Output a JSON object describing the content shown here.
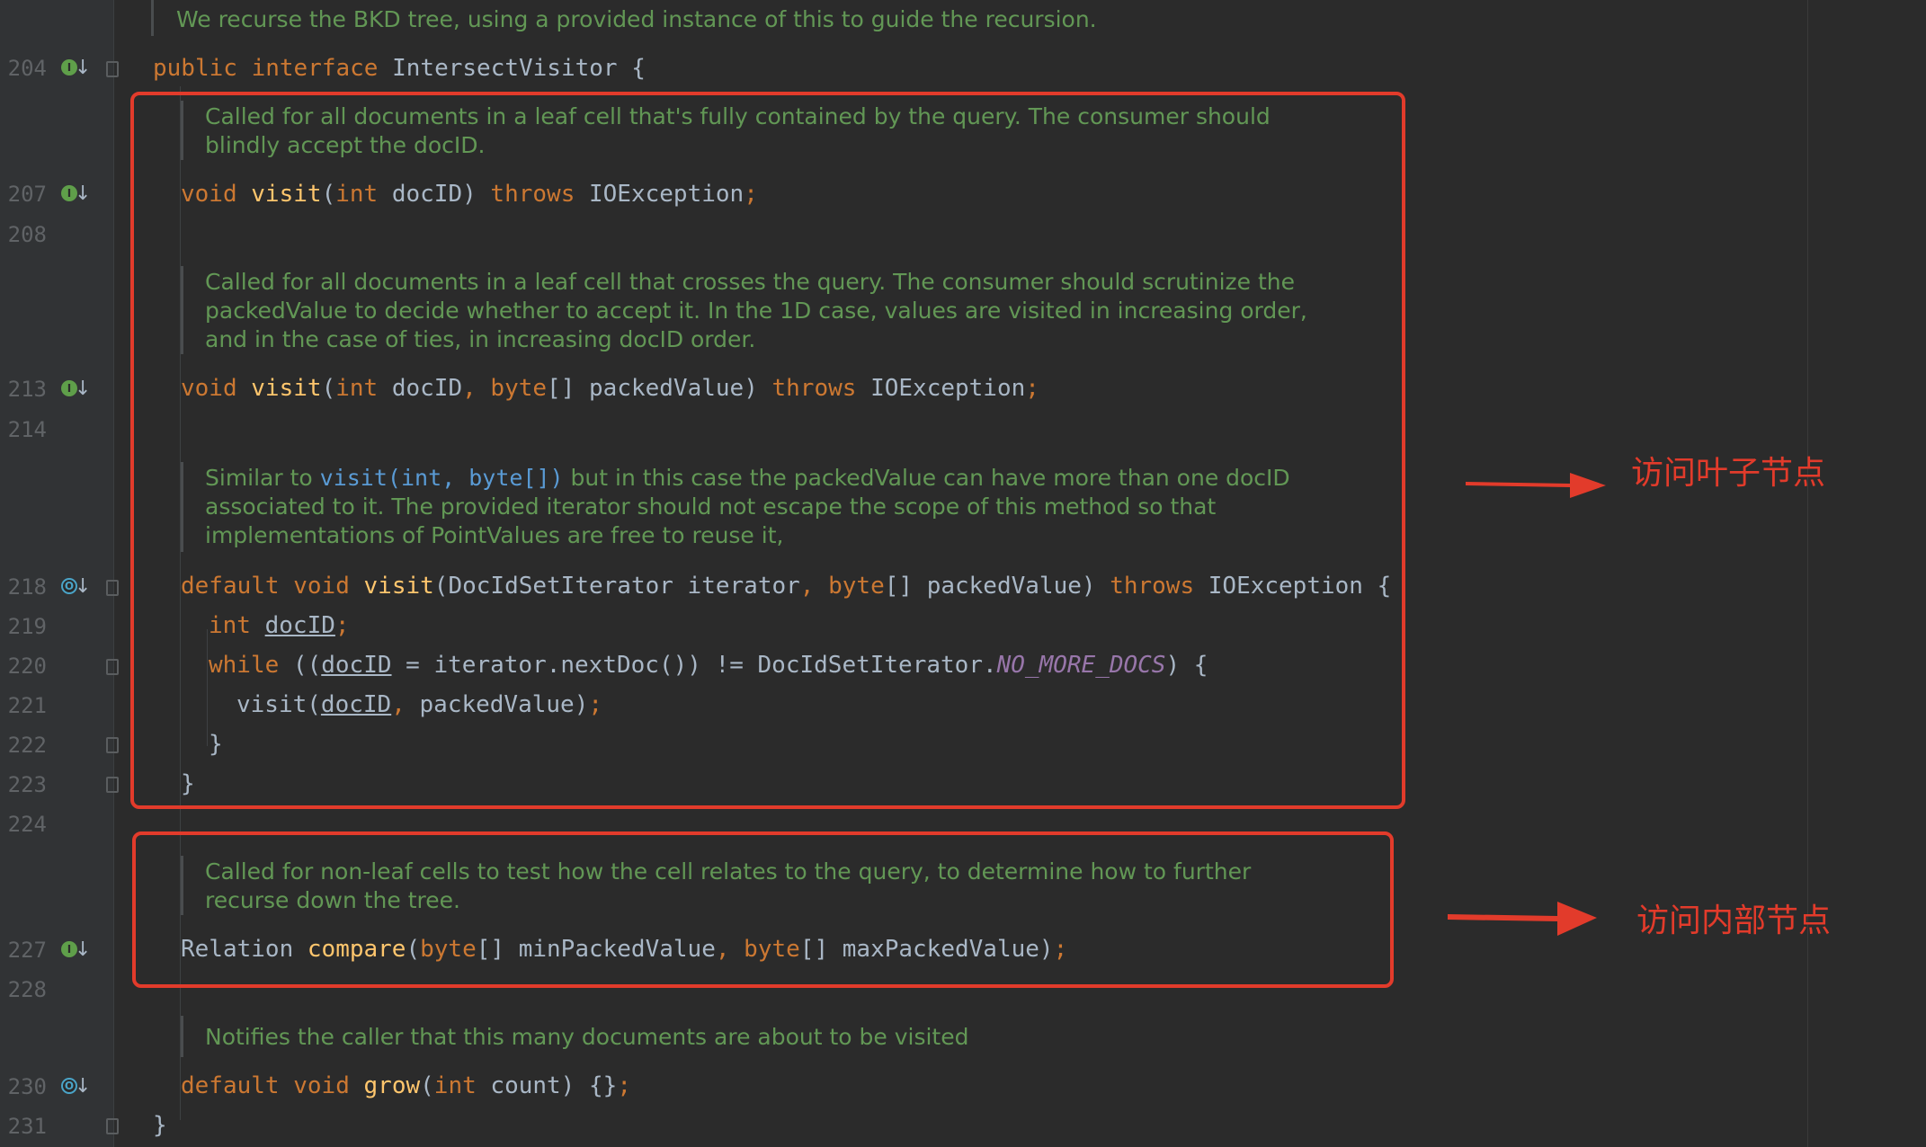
{
  "header_doc": "We recurse the BKD tree, using a provided instance of this to guide the recursion.",
  "decl": {
    "kw1": "public",
    "kw2": "interface",
    "name": "IntersectVisitor",
    "brace": "{"
  },
  "doc_visit1": "Called for all documents in a leaf cell that's fully contained by the query. The consumer should blindly accept the docID.",
  "visit1": {
    "void": "void",
    "name": "visit",
    "p1": "(",
    "int": "int",
    "arg": " docID) ",
    "throws": "throws",
    "exc": " IOException",
    "semi": ";"
  },
  "doc_visit2": "Called for all documents in a leaf cell that crosses the query. The consumer should scrutinize the packedValue to decide whether to accept it. In the 1D case, values are visited in increasing order, and in the case of ties, in increasing docID order.",
  "visit2": {
    "void": "void",
    "name": "visit",
    "p1": "(",
    "int": "int",
    "arg1": " docID",
    "comma": ", ",
    "byte": "byte",
    "arg2": "[] packedValue) ",
    "throws": "throws",
    "exc": " IOException",
    "semi": ";"
  },
  "doc_visit3": {
    "pre": "Similar to ",
    "link": "visit(int, byte[])",
    "post": " but in this case the packedValue can have more than one docID associated to it. The provided iterator should not escape the scope of this method so that implementations of PointValues are free to reuse it,"
  },
  "visit3": {
    "default": "default",
    "void": "void",
    "name": "visit",
    "arg1": "(DocIdSetIterator iterator",
    "comma": ", ",
    "byte": "byte",
    "arg2": "[] packedValue) ",
    "throws": "throws",
    "exc": " IOException {"
  },
  "body": {
    "l219": {
      "int": "int",
      "var": "docID",
      "semi": ";"
    },
    "l220": {
      "while": "while",
      "p": " ((",
      "var": "docID",
      "mid": " = iterator.nextDoc()) != DocIdSetIterator.",
      "const": "NO_MORE_DOCS",
      "end": ") {"
    },
    "l221": {
      "call": "visit(",
      "var": "docID",
      "comma": ", ",
      "rest": "packedValue)",
      "semi": ";"
    },
    "l222": "}",
    "l223": "}"
  },
  "doc_compare": "Called for non-leaf cells to test how the cell relates to the query, to determine how to further recurse down the tree.",
  "compare": {
    "type": "Relation ",
    "name": "compare",
    "p": "(",
    "byte1": "byte",
    "a1": "[] minPackedValue",
    "comma": ", ",
    "byte2": "byte",
    "a2": "[] maxPackedValue)",
    "semi": ";"
  },
  "doc_grow": "Notifies the caller that this many documents are about to be visited",
  "grow": {
    "default": "default",
    "void": "void",
    "name": "grow",
    "p": "(",
    "int": "int",
    "arg": " count) {}",
    "semi": ";"
  },
  "close": "}",
  "line_numbers": {
    "l204": "204",
    "l207": "207",
    "l208": "208",
    "l213": "213",
    "l214": "214",
    "l218": "218",
    "l219": "219",
    "l220": "220",
    "l221": "221",
    "l222": "222",
    "l223": "223",
    "l224": "224",
    "l227": "227",
    "l228": "228",
    "l230": "230",
    "l231": "231"
  },
  "gutter_icons": {
    "implemented": "I",
    "overriding": "O",
    "arrow": "↓"
  },
  "annotations": {
    "leaf_label": "访问叶子节点",
    "internal_label": "访问内部节点",
    "color": "#e23b2b"
  },
  "colors": {
    "background": "#2b2b2b",
    "keyword": "#cc7832",
    "function": "#ffc66d",
    "doc_comment": "#629755",
    "text": "#a9b7c6",
    "constant": "#9876aa"
  }
}
